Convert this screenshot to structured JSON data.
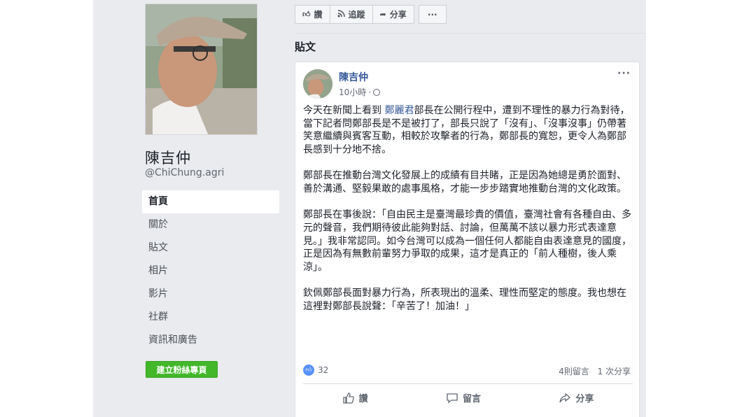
{
  "page": {
    "name": "陳吉仲",
    "handle": "@ChiChung.agri"
  },
  "nav": {
    "items": [
      {
        "label": "首頁",
        "active": true
      },
      {
        "label": "關於"
      },
      {
        "label": "貼文"
      },
      {
        "label": "相片"
      },
      {
        "label": "影片"
      },
      {
        "label": "社群"
      },
      {
        "label": "資訊和廣告"
      }
    ],
    "create_button": "建立粉絲專頁"
  },
  "action_bar": {
    "like": "讚",
    "follow": "追蹤",
    "share": "分享",
    "more": "···"
  },
  "section_title": "貼文",
  "post": {
    "author": "陳吉仲",
    "time": "10小時",
    "more": "···",
    "paragraphs": [
      {
        "before": "今天在新聞上看到 ",
        "mention": "鄭麗君",
        "after": "部長在公開行程中，遭到不理性的暴力行為對待，當下記者問鄭部長是不是被打了，部長只說了「沒有」、「沒事沒事」仍帶著笑意繼續與賓客互動，相較於攻擊者的行為，鄭部長的寬恕，更令人為鄭部長感到十分地不捨。"
      },
      {
        "before": "鄭部長在推動台灣文化發展上的成績有目共睹，正是因為她總是勇於面對、善於溝通、堅毅果敢的處事風格，才能一步步踏實地推動台灣的文化政策。",
        "mention": "",
        "after": ""
      },
      {
        "before": "鄭部長在事後說：「自由民主是臺灣最珍貴的價值，臺灣社會有各種自由、多元的聲音，我們期待彼此能夠對話、討論，但萬萬不該以暴力形式表達意見。」我非常認同。如今台灣可以成為一個任何人都能自由表達意見的國度，正是因為有無數前輩努力爭取的成果，這才是真正的「前人種樹，後人乘涼」。",
        "mention": "",
        "after": ""
      },
      {
        "before": "欽佩鄭部長面對暴力行為，所表現出的溫柔、理性而堅定的態度。我也想在這裡對鄭部長說聲：「辛苦了！加油！」",
        "mention": "",
        "after": ""
      }
    ],
    "reaction_count": "32",
    "comments": "4則留言",
    "shares": "1 次分享",
    "actions": {
      "like": "讚",
      "comment": "留言",
      "share": "分享"
    }
  },
  "colors": {
    "background": "#e9ebee",
    "link": "#365899",
    "create_button": "#42b72a",
    "like_blue": "#5890ff"
  }
}
